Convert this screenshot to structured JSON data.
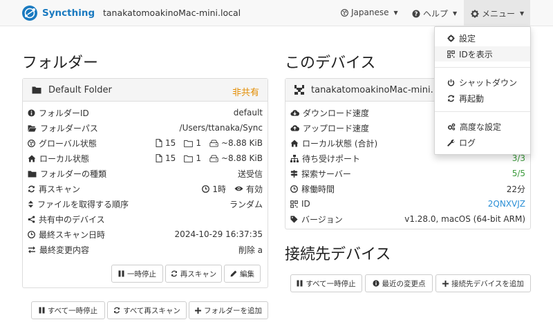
{
  "app": {
    "name": "Syncthing",
    "hostname": "tanakatomoakinoMac-mini.local"
  },
  "nav": {
    "language_label": "Japanese",
    "help_label": "ヘルプ",
    "menu_label": "メニュー"
  },
  "menu": {
    "items": [
      {
        "label": "設定",
        "icon": "gear-icon"
      },
      {
        "label": "IDを表示",
        "icon": "qrcode-icon"
      },
      {
        "label": "シャットダウン",
        "icon": "power-icon"
      },
      {
        "label": "再起動",
        "icon": "refresh-icon"
      },
      {
        "label": "高度な設定",
        "icon": "cogs-icon"
      },
      {
        "label": "ログ",
        "icon": "wrench-icon"
      }
    ]
  },
  "folders": {
    "heading": "フォルダー",
    "panel": {
      "title": "Default Folder",
      "status": "非共有",
      "rows": [
        {
          "label": "フォルダーID",
          "value": "default"
        },
        {
          "label": "フォルダーパス",
          "value": "/Users/ttanaka/Sync"
        },
        {
          "label": "グローバル状態",
          "files": "15",
          "dirs": "1",
          "size": "~8.88 KiB"
        },
        {
          "label": "ローカル状態",
          "files": "15",
          "dirs": "1",
          "size": "~8.88 KiB"
        },
        {
          "label": "フォルダーの種類",
          "value": "送受信"
        },
        {
          "label": "再スキャン",
          "interval": "1時",
          "watch": "有効"
        },
        {
          "label": "ファイルを取得する順序",
          "value": "ランダム"
        },
        {
          "label": "共有中のデバイス",
          "value": ""
        },
        {
          "label": "最終スキャン日時",
          "value": "2024-10-29 16:37:35"
        },
        {
          "label": "最終変更内容",
          "value": "削除 a"
        }
      ],
      "buttons": {
        "pause": "一時停止",
        "rescan": "再スキャン",
        "edit": "編集"
      }
    },
    "buttons": {
      "pause_all": "すべて一時停止",
      "rescan_all": "すべて再スキャン",
      "add_folder": "フォルダーを追加"
    }
  },
  "device": {
    "heading": "このデバイス",
    "name": "tanakatomoakinoMac-mini.",
    "rows": [
      {
        "label": "ダウンロード速度",
        "value": ""
      },
      {
        "label": "アップロード速度",
        "value": ""
      },
      {
        "label": "ローカル状態 (合計)",
        "value": ""
      },
      {
        "label": "待ち受けポート",
        "value": "3/3"
      },
      {
        "label": "探索サーバー",
        "value": "5/5"
      },
      {
        "label": "稼働時間",
        "value": "22分"
      },
      {
        "label": "ID",
        "value": "2QNXVJZ"
      },
      {
        "label": "バージョン",
        "value": "v1.28.0, macOS (64-bit ARM)"
      }
    ]
  },
  "remote": {
    "heading": "接続先デバイス",
    "buttons": {
      "pause_all": "すべて一時停止",
      "recent_changes": "最近の変更点",
      "add_device": "接続先デバイスを追加"
    }
  },
  "colors": {
    "brand": "#1a7ac0",
    "unshared": "#e38c00",
    "ok": "#3a9a3a",
    "link": "#2b8fd6"
  }
}
